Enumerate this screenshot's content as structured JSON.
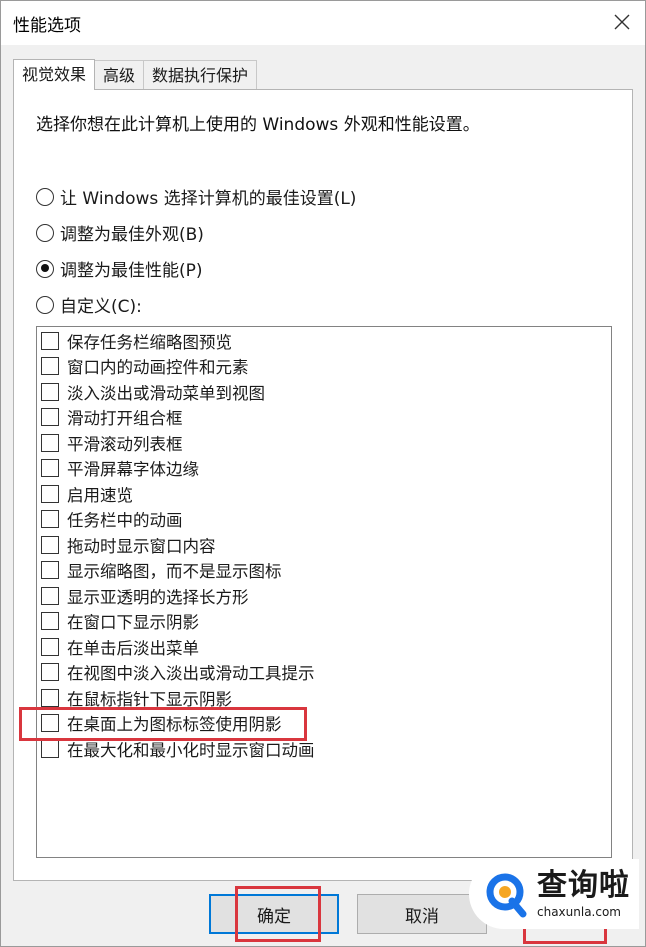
{
  "window": {
    "title": "性能选项"
  },
  "tabs": [
    {
      "label": "视觉效果",
      "active": true
    },
    {
      "label": "高级",
      "active": false
    },
    {
      "label": "数据执行保护",
      "active": false
    }
  ],
  "panel": {
    "description": "选择你想在此计算机上使用的 Windows 外观和性能设置。",
    "radios": [
      {
        "label": "让 Windows 选择计算机的最佳设置(L)",
        "checked": false
      },
      {
        "label": "调整为最佳外观(B)",
        "checked": false
      },
      {
        "label": "调整为最佳性能(P)",
        "checked": true
      },
      {
        "label": "自定义(C):",
        "checked": false
      }
    ],
    "options": [
      {
        "label": "保存任务栏缩略图预览",
        "checked": false
      },
      {
        "label": "窗口内的动画控件和元素",
        "checked": false
      },
      {
        "label": "淡入淡出或滑动菜单到视图",
        "checked": false
      },
      {
        "label": "滑动打开组合框",
        "checked": false
      },
      {
        "label": "平滑滚动列表框",
        "checked": false
      },
      {
        "label": "平滑屏幕字体边缘",
        "checked": false
      },
      {
        "label": "启用速览",
        "checked": false
      },
      {
        "label": "任务栏中的动画",
        "checked": false
      },
      {
        "label": "拖动时显示窗口内容",
        "checked": false
      },
      {
        "label": "显示缩略图，而不是显示图标",
        "checked": false
      },
      {
        "label": "显示亚透明的选择长方形",
        "checked": false
      },
      {
        "label": "在窗口下显示阴影",
        "checked": false
      },
      {
        "label": "在单击后淡出菜单",
        "checked": false
      },
      {
        "label": "在视图中淡入淡出或滑动工具提示",
        "checked": false
      },
      {
        "label": "在鼠标指针下显示阴影",
        "checked": false
      },
      {
        "label": "在桌面上为图标标签使用阴影",
        "checked": false
      },
      {
        "label": "在最大化和最小化时显示窗口动画",
        "checked": false
      }
    ]
  },
  "buttons": {
    "ok": "确定",
    "cancel": "取消"
  },
  "watermark": {
    "name": "查询啦",
    "url": "chaxunla.com",
    "brand_color": "#1a73e8",
    "accent_color": "#f5a623"
  },
  "annotation_color": "#d9363e",
  "icons": {
    "close": "close-icon",
    "logo": "search-logo-icon"
  }
}
